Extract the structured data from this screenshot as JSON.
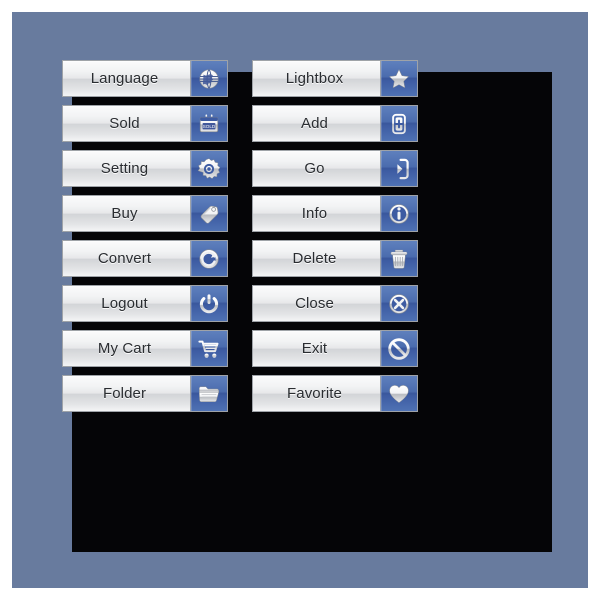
{
  "canvas": {
    "background_color": "#ffffff",
    "frame_color": "#687b9e",
    "panel_color": "#050507"
  },
  "theme": {
    "button_face_start": "#fbfbfc",
    "button_face_end": "#f4f5f6",
    "button_border": "#9fa3a8",
    "icon_panel_blue": "#3f5fa6",
    "label_color": "#2a2d31",
    "icon_glyph_color": "#ffffff"
  },
  "columns": [
    {
      "name": "left-column",
      "buttons": [
        {
          "label": "Language",
          "icon": "globe-icon"
        },
        {
          "label": "Sold",
          "icon": "calendar-sold-icon"
        },
        {
          "label": "Setting",
          "icon": "gear-icon"
        },
        {
          "label": "Buy",
          "icon": "price-tag-icon"
        },
        {
          "label": "Convert",
          "icon": "convert-circle-icon"
        },
        {
          "label": "Logout",
          "icon": "power-icon"
        },
        {
          "label": "My Cart",
          "icon": "shopping-cart-icon"
        },
        {
          "label": "Folder",
          "icon": "folder-icon"
        }
      ]
    },
    {
      "name": "right-column",
      "buttons": [
        {
          "label": "Lightbox",
          "icon": "star-icon"
        },
        {
          "label": "Add",
          "icon": "add-box-icon"
        },
        {
          "label": "Go",
          "icon": "go-arrow-icon"
        },
        {
          "label": "Info",
          "icon": "info-circle-icon"
        },
        {
          "label": "Delete",
          "icon": "trash-icon"
        },
        {
          "label": "Close",
          "icon": "close-circle-icon"
        },
        {
          "label": "Exit",
          "icon": "prohibition-icon"
        },
        {
          "label": "Favorite",
          "icon": "heart-icon"
        }
      ]
    }
  ]
}
